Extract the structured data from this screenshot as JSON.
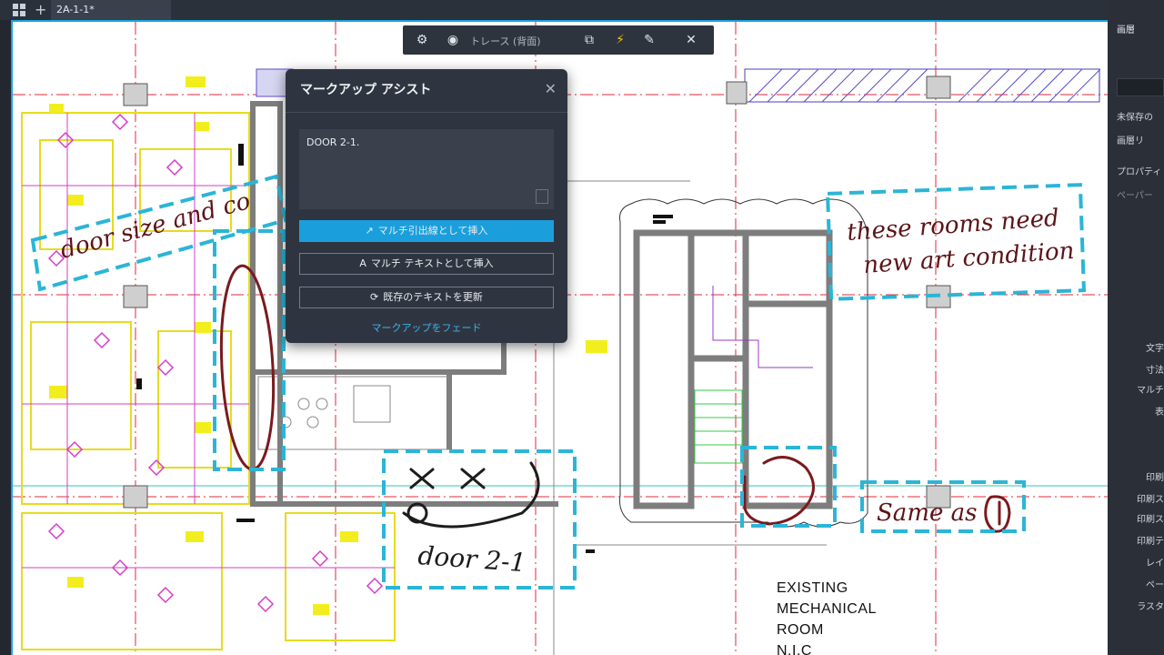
{
  "window": {
    "tab_title": "2A-1-1*",
    "new_tab_glyph": "+"
  },
  "trace_toolbar": {
    "label": "トレース (背面)",
    "icons": [
      "gear-icon",
      "profile-icon",
      "compare-icon",
      "flash-icon",
      "markup-edit-icon",
      "close-icon"
    ],
    "close_glyph": "✕"
  },
  "markup_assist": {
    "title": "マークアップ アシスト",
    "close_glyph": "✕",
    "recognized_text": "DOOR 2-1.",
    "insert_mleader_label": "マルチ引出線として挿入",
    "insert_mtext_label": "マルチ テキストとして挿入",
    "update_text_label": "既存のテキストを更新",
    "fade_markup_label": "マークアップをフェード",
    "accent_color": "#1a9fdc"
  },
  "right_panel": {
    "layer_title": "画層",
    "unsaved_label": "未保存の",
    "layer_list_label": "画層リ",
    "properties_label": "プロパティ",
    "paper_label": "ペーパー",
    "props": [
      "文字",
      "寸法",
      "マルチ",
      "表",
      "印刷",
      "印刷ス",
      "印刷ス",
      "印刷テ",
      "レイ",
      "ペー",
      "ラスタ"
    ]
  },
  "drawing": {
    "handwritten_notes": [
      "door size and co",
      "these rooms need",
      "new art condition",
      "Same as (1)",
      "door 2-1",
      "X X",
      "(2)"
    ],
    "room_label": [
      "EXISTING",
      "MECHANICAL",
      "ROOM",
      "N.I.C"
    ],
    "markup_color": "#7a1a1f",
    "highlight_color": "#2bb5d6"
  }
}
